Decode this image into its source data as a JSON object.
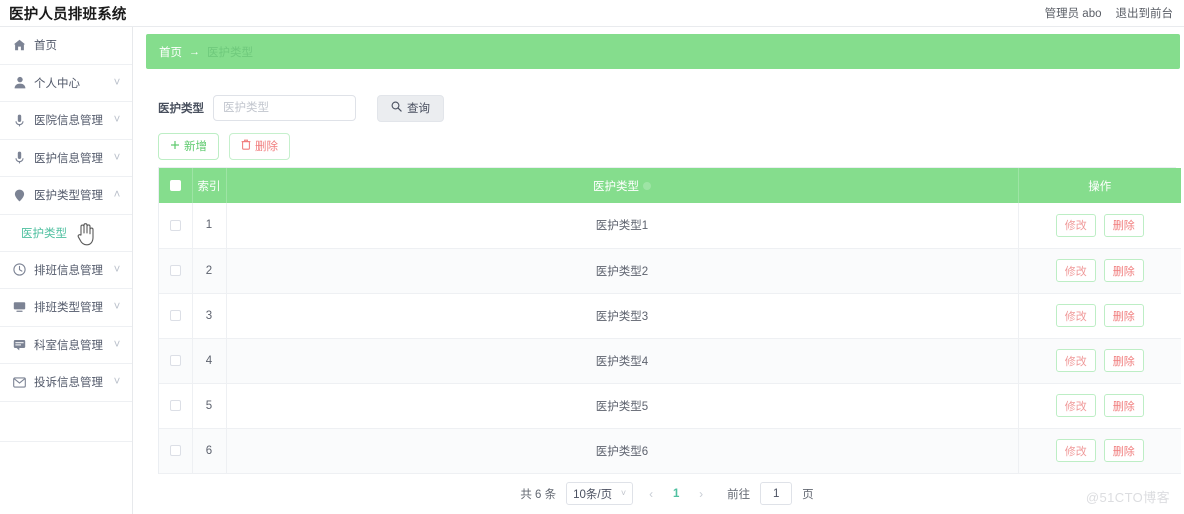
{
  "app": {
    "title": "医护人员排班系统",
    "accent_green": "#85dd8d",
    "accent_teal": "#4fc0a0",
    "danger_red": "#f07c7c"
  },
  "header": {
    "user_label": "管理员 abo",
    "logout_label": "退出到前台"
  },
  "sidebar": {
    "items": [
      {
        "label": "首页",
        "icon": "home-icon",
        "arrow": "",
        "expandable": false
      },
      {
        "label": "个人中心",
        "icon": "user-icon",
        "arrow": "˅",
        "expandable": true
      },
      {
        "label": "医院信息管理",
        "icon": "pin-icon",
        "arrow": "˅",
        "expandable": true
      },
      {
        "label": "医护信息管理",
        "icon": "mic-icon",
        "arrow": "˅",
        "expandable": true
      },
      {
        "label": "医护类型管理",
        "icon": "location-icon",
        "arrow": "˄",
        "expandable": true
      },
      {
        "label": "排班信息管理",
        "icon": "clock-icon",
        "arrow": "˅",
        "expandable": true
      },
      {
        "label": "排班类型管理",
        "icon": "monitor-icon",
        "arrow": "˅",
        "expandable": true
      },
      {
        "label": "科室信息管理",
        "icon": "chat-icon",
        "arrow": "˅",
        "expandable": true
      },
      {
        "label": "投诉信息管理",
        "icon": "mail-icon",
        "arrow": "˅",
        "expandable": true
      }
    ],
    "submenu": {
      "label": "医护类型",
      "active": true
    }
  },
  "breadcrumb": {
    "home": "首页",
    "separator": "→",
    "current": "医护类型"
  },
  "search": {
    "label": "医护类型",
    "placeholder": "医护类型",
    "value": "",
    "button_label": "查询",
    "button_icon": "search-icon"
  },
  "toolbar": {
    "add_label": "新增",
    "add_icon": "plus-icon",
    "delete_label": "删除",
    "delete_icon": "trash-icon"
  },
  "table": {
    "columns": [
      {
        "key": "check",
        "label": "",
        "icon": "select-all-checkbox"
      },
      {
        "key": "index",
        "label": "索引"
      },
      {
        "key": "type",
        "label": "医护类型",
        "sortable": true
      },
      {
        "key": "ops",
        "label": "操作"
      }
    ],
    "rows": [
      {
        "index": "1",
        "type": "医护类型1",
        "edit": "修改",
        "remove": "删除"
      },
      {
        "index": "2",
        "type": "医护类型2",
        "edit": "修改",
        "remove": "删除"
      },
      {
        "index": "3",
        "type": "医护类型3",
        "edit": "修改",
        "remove": "删除"
      },
      {
        "index": "4",
        "type": "医护类型4",
        "edit": "修改",
        "remove": "删除"
      },
      {
        "index": "5",
        "type": "医护类型5",
        "edit": "修改",
        "remove": "删除"
      },
      {
        "index": "6",
        "type": "医护类型6",
        "edit": "修改",
        "remove": "删除"
      }
    ]
  },
  "pagination": {
    "total_label": "共 6 条",
    "page_size_label": "10条/页",
    "prev_icon": "‹",
    "next_icon": "›",
    "current_page": "1",
    "jump_label": "前往",
    "jump_value": "1",
    "jump_unit": "页"
  },
  "watermark": {
    "text": "@51CTO博客"
  }
}
